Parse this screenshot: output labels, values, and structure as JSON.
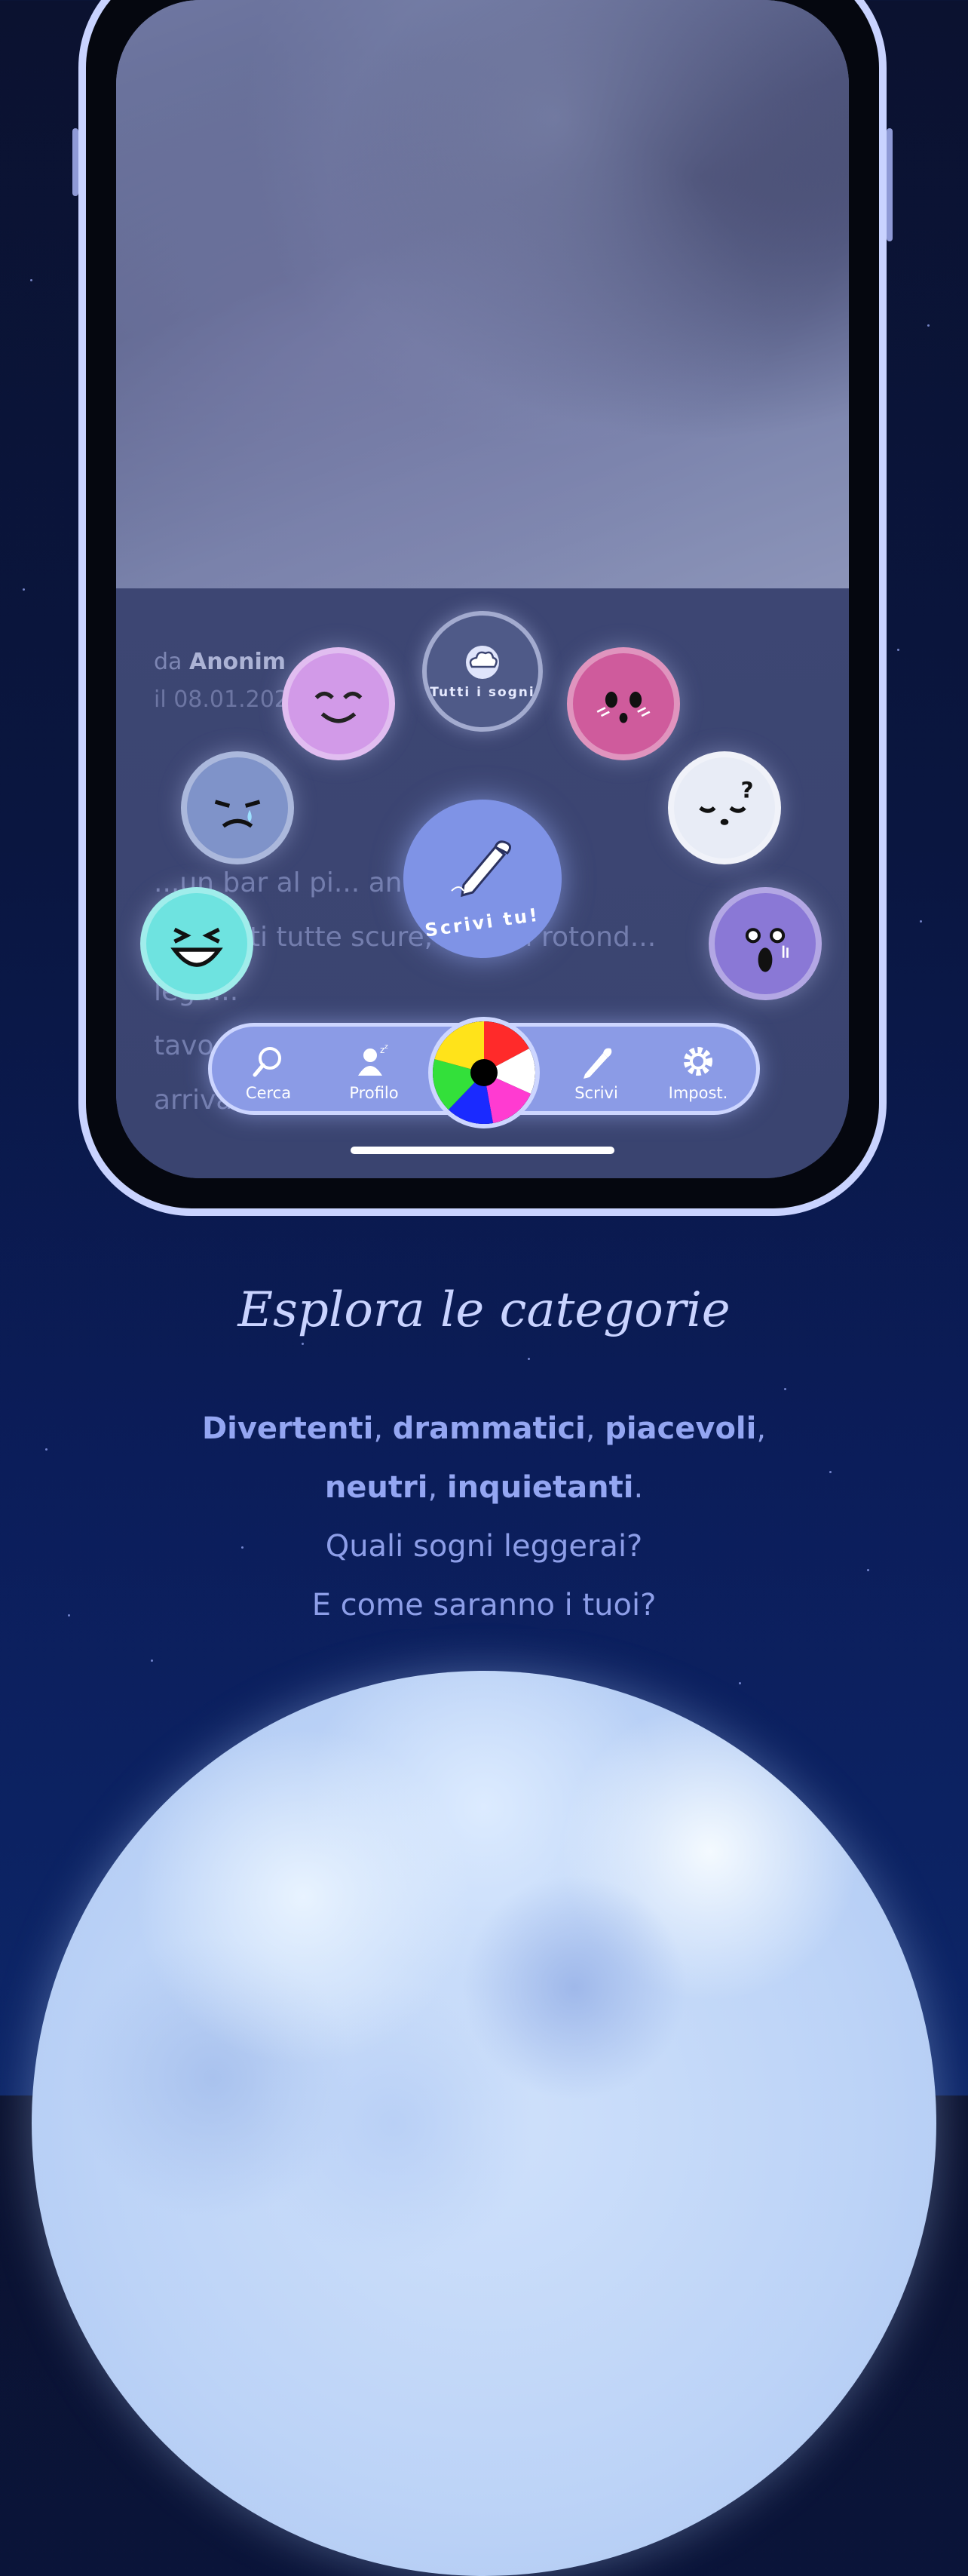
{
  "story": {
    "author_prefix": "da",
    "author": "Anonim",
    "date": "il 08.01.2026 ... 19",
    "lines": [
      "...un bar al pi... ano di un e...",
      "... pareti tutte scure, i tavoli rotond...",
      "legn...",
      "tavo...",
      "arriva un altro mio amico che mi dice che"
    ]
  },
  "categories": {
    "all_label": "Tutti i sogni",
    "write_label": "Scrivi tu!",
    "items": [
      {
        "name": "piacevoli",
        "color": "#d29ae8"
      },
      {
        "name": "divertenti",
        "color": "#6ee3e0"
      },
      {
        "name": "drammatici",
        "color": "#7f93c9"
      },
      {
        "name": "inquietanti",
        "color": "#8a78d6"
      },
      {
        "name": "neutri",
        "color": "#e8ecf6"
      },
      {
        "name": "imbarazzanti",
        "color": "#cf5b9c"
      }
    ]
  },
  "nav": {
    "search": "Cerca",
    "profile": "Profilo",
    "write": "Scrivi",
    "settings": "Impost."
  },
  "promo": {
    "headline": "Esplora le categorie",
    "line1_a": "Divertenti",
    "line1_b": "drammatici",
    "line1_c": "piacevoli",
    "line2_a": "neutri",
    "line2_b": "inquietanti",
    "line3": "Quali sogni leggerai?",
    "line4": "E come saranno i tuoi?"
  },
  "colors": {
    "accent": "#8b9be6",
    "text": "#8d9ee8",
    "headline": "#c9d3ff"
  }
}
